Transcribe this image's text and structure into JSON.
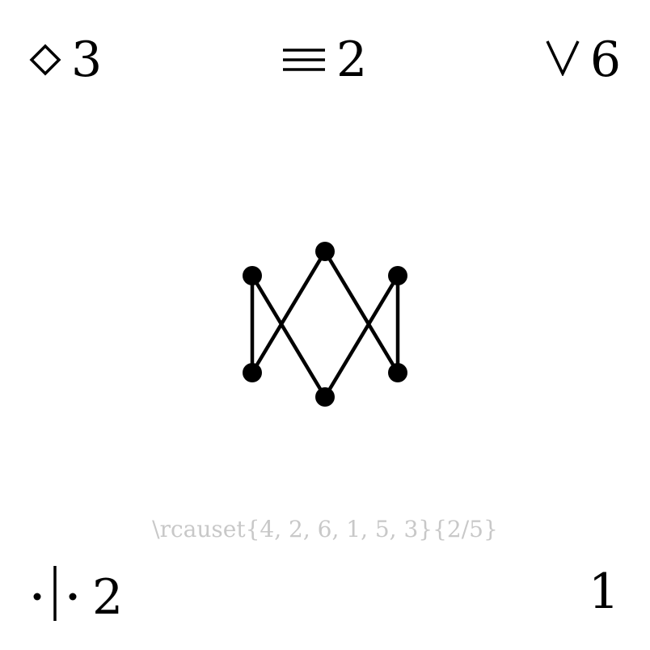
{
  "corners": {
    "top_left": {
      "icon": "diamond-icon",
      "value": "3"
    },
    "top_center": {
      "icon": "equivalence-icon",
      "value": "2"
    },
    "top_right": {
      "icon": "logical-or-icon",
      "value": "6"
    },
    "bottom_left": {
      "icon": "dot-bar-dot-icon",
      "value": "2"
    },
    "bottom_right": {
      "value": "1"
    }
  },
  "caption": "\\rcauset{4, 2, 6, 1, 5, 3}{2/5}",
  "graph": {
    "nodes": [
      "1",
      "2",
      "3",
      "4",
      "5",
      "6"
    ],
    "edges": [
      [
        "1",
        "4"
      ],
      [
        "1",
        "2"
      ],
      [
        "5",
        "2"
      ],
      [
        "5",
        "6"
      ],
      [
        "3",
        "4"
      ],
      [
        "3",
        "6"
      ]
    ]
  }
}
